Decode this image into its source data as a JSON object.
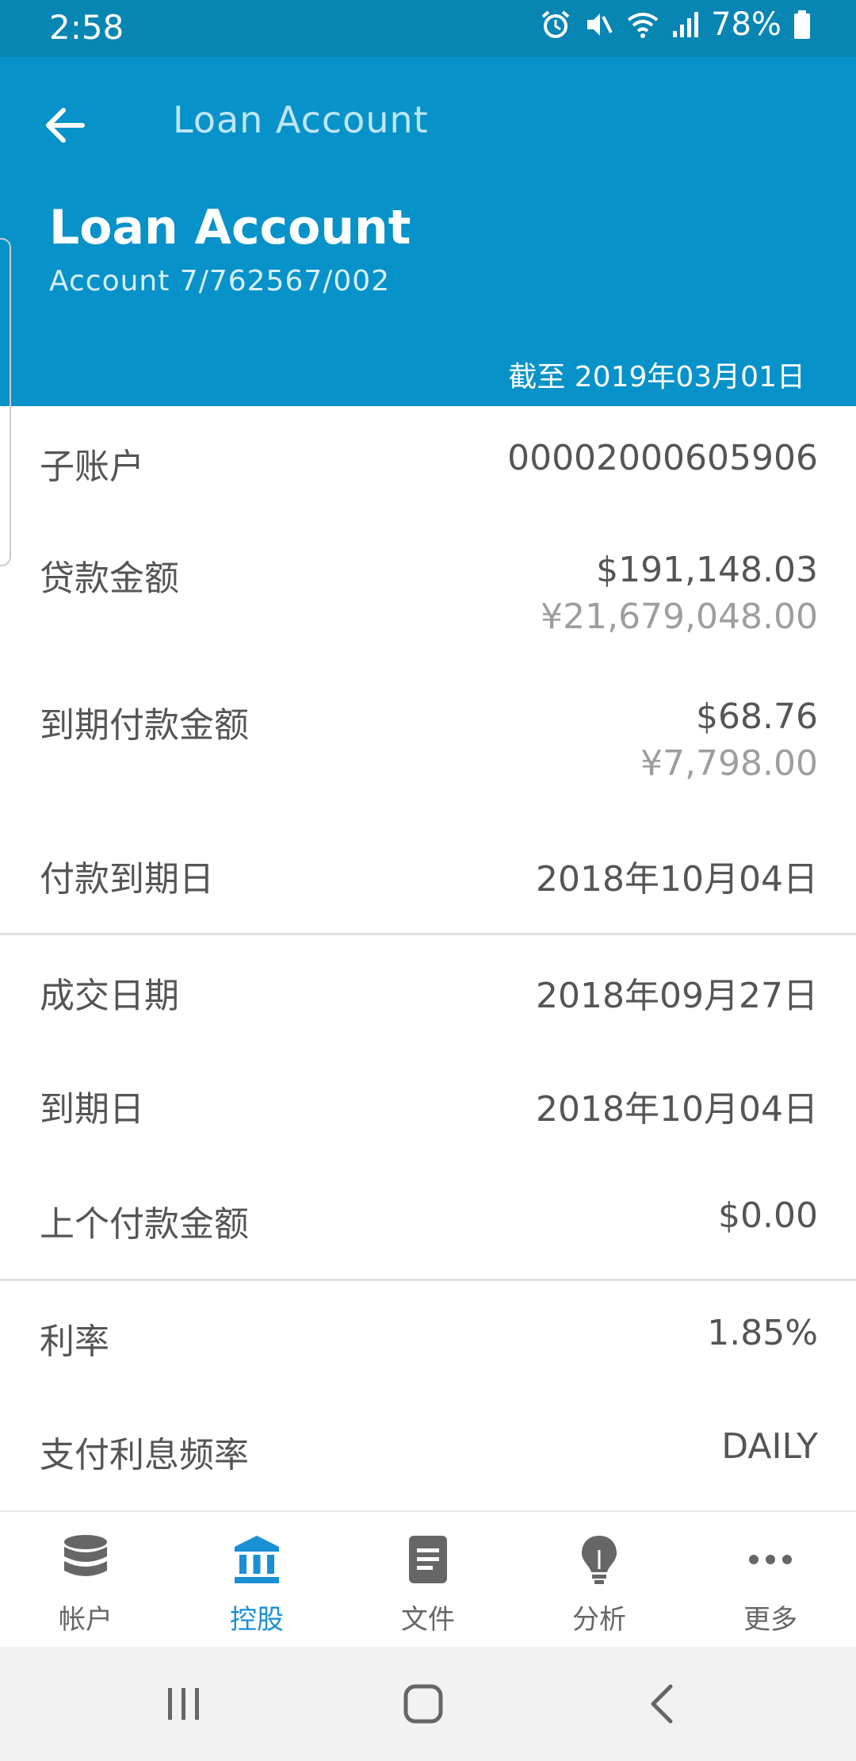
{
  "status_bar": {
    "time": "2:58",
    "battery": "78%"
  },
  "header": {
    "toolbar_title": "Loan Account",
    "title": "Loan Account",
    "subtitle": "Account 7/762567/002",
    "as_of": "截至 2019年03月01日"
  },
  "details": [
    {
      "label": "子账户",
      "value": "00002000605906"
    },
    {
      "label": "贷款金额",
      "value": "$191,148.03",
      "value2": "¥21,679,048.00"
    },
    {
      "label": "到期付款金额",
      "value": "$68.76",
      "value2": "¥7,798.00"
    },
    {
      "label": "付款到期日",
      "value": "2018年10月04日"
    },
    {
      "label": "成交日期",
      "value": "2018年09月27日"
    },
    {
      "label": "到期日",
      "value": "2018年10月04日"
    },
    {
      "label": "上个付款金额",
      "value": "$0.00"
    },
    {
      "label": "利率",
      "value": "1.85%"
    },
    {
      "label": "支付利息频率",
      "value": "DAILY"
    }
  ],
  "bottom_nav": [
    {
      "label": "帐户",
      "icon": "database-icon"
    },
    {
      "label": "控股",
      "icon": "bank-icon",
      "active": true
    },
    {
      "label": "文件",
      "icon": "document-icon"
    },
    {
      "label": "分析",
      "icon": "lightbulb-icon"
    },
    {
      "label": "更多",
      "icon": "more-icon"
    }
  ],
  "colors": {
    "header_bg": "#0792c9",
    "status_bg": "#0785b3",
    "active_nav": "#1a8fd4"
  }
}
